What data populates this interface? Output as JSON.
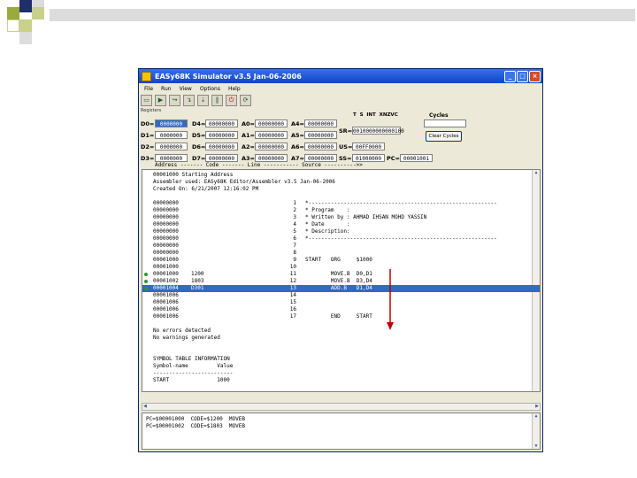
{
  "colors": {
    "title_blue": "#0a46c8",
    "select_blue": "#316ac5",
    "deco_green": "#9aaa3c",
    "deco_navy": "#1f2f6b",
    "arrow_red": "#c00000"
  },
  "window": {
    "title": "EASy68K Simulator v3.5 Jan-06-2006"
  },
  "menu": [
    "File",
    "Run",
    "View",
    "Options",
    "Help"
  ],
  "toolbar": [
    {
      "name": "open-icon",
      "glyph": "▭"
    },
    {
      "name": "run-icon",
      "glyph": "▶"
    },
    {
      "name": "step-over-icon",
      "glyph": "↪"
    },
    {
      "name": "trace-icon",
      "glyph": "↴"
    },
    {
      "name": "step-icon",
      "glyph": "⇣"
    },
    {
      "name": "pause-icon",
      "glyph": "‖"
    },
    {
      "name": "reset-icon",
      "glyph": "⏻"
    },
    {
      "name": "reload-icon",
      "glyph": "⟳"
    }
  ],
  "registers_label": "Registers",
  "data_regs": [
    {
      "label": "D0=",
      "value": "0000000",
      "sel": true
    },
    {
      "label": "D1=",
      "value": "0000000"
    },
    {
      "label": "D2=",
      "value": "0000000"
    },
    {
      "label": "D3=",
      "value": "0000000"
    },
    {
      "label": "D4=",
      "value": "00000000"
    },
    {
      "label": "D5=",
      "value": "00000000"
    },
    {
      "label": "D6=",
      "value": "00000000"
    },
    {
      "label": "D7=",
      "value": "00000000"
    }
  ],
  "addr_regs": [
    {
      "label": "A0=",
      "value": "00000000"
    },
    {
      "label": "A1=",
      "value": "00000000"
    },
    {
      "label": "A2=",
      "value": "00000000"
    },
    {
      "label": "A3=",
      "value": "00000000"
    },
    {
      "label": "A4=",
      "value": "00000000"
    },
    {
      "label": "A5=",
      "value": "00000000"
    },
    {
      "label": "A6=",
      "value": "00000000"
    },
    {
      "label": "A7=",
      "value": "00000000"
    }
  ],
  "flags_header": "T  S  INT  XNZVC",
  "cycles_header": "Cycles",
  "sr": {
    "label": "SR=",
    "value": "0010000000000100"
  },
  "us": {
    "label": "US=",
    "value": "00FF0000"
  },
  "ss": {
    "label": "SS=",
    "value": "01000000"
  },
  "pc": {
    "label": "PC=",
    "value": "00001001"
  },
  "clear_cycles": "Clear Cycles",
  "column_header": "Address ------- Code ------- Line ----------- Source ---------->>",
  "listing_rows": [
    {
      "full": "00001000 Starting Address"
    },
    {
      "full": "Assembler used: EASy68K Editor/Assembler v3.5 Jan-06-2006"
    },
    {
      "full": "Created On: 6/21/2007 12:16:02 PM"
    },
    {
      "full": ""
    },
    {
      "addr": "00000000",
      "code": "",
      "line": "1",
      "src": "*-----------------------------------------------------------"
    },
    {
      "addr": "00000000",
      "code": "",
      "line": "2",
      "src": "* Program    :"
    },
    {
      "addr": "00000000",
      "code": "",
      "line": "3",
      "src": "* Written by : AHMAD IHSAN MOHD YASSIN"
    },
    {
      "addr": "00000000",
      "code": "",
      "line": "4",
      "src": "* Date       :"
    },
    {
      "addr": "00000000",
      "code": "",
      "line": "5",
      "src": "* Description:"
    },
    {
      "addr": "00000000",
      "code": "",
      "line": "6",
      "src": "*-----------------------------------------------------------"
    },
    {
      "addr": "00000000",
      "code": "",
      "line": "7",
      "src": ""
    },
    {
      "addr": "00000000",
      "code": "",
      "line": "8",
      "src": ""
    },
    {
      "addr": "00001000",
      "code": "",
      "line": "9",
      "src": "START   ORG     $1000"
    },
    {
      "addr": "00001000",
      "code": "",
      "line": "10",
      "src": ""
    },
    {
      "addr": "00001000",
      "code": "1200",
      "line": "11",
      "src": "        MOVE.B  D0,D1",
      "bp": true
    },
    {
      "addr": "00001002",
      "code": "1803",
      "line": "12",
      "src": "        MOVE.B  D3,D4",
      "bp": true
    },
    {
      "addr": "00001004",
      "code": "D301",
      "line": "13",
      "src": "        ADD.B   D1,D4",
      "bp": true,
      "sel": true
    },
    {
      "addr": "00001006",
      "code": "",
      "line": "14",
      "src": ""
    },
    {
      "addr": "00001006",
      "code": "",
      "line": "15",
      "src": ""
    },
    {
      "addr": "00001006",
      "code": "",
      "line": "16",
      "src": ""
    },
    {
      "addr": "00001006",
      "code": "",
      "line": "17",
      "src": "        END     START"
    },
    {
      "full": ""
    },
    {
      "full": "No errors detected"
    },
    {
      "full": "No warnings generated"
    },
    {
      "full": ""
    },
    {
      "full": ""
    },
    {
      "full": "SYMBOL TABLE INFORMATION"
    },
    {
      "full": "Symbol-name         Value"
    },
    {
      "full": "-------------------------"
    },
    {
      "full": "START               1000"
    }
  ],
  "output_lines": [
    "PC=$00001000  CODE=$1200  MOVEB",
    "PC=$00001002  CODE=$1803  MOVEB"
  ]
}
